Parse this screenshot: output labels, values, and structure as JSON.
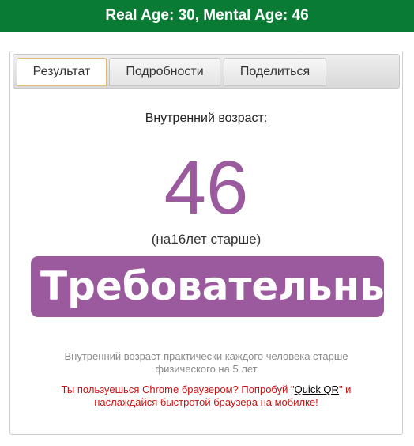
{
  "header": {
    "title": "Real Age: 30, Mental Age: 46"
  },
  "tabs": [
    {
      "label": "Результат",
      "active": true
    },
    {
      "label": "Подробности",
      "active": false
    },
    {
      "label": "Поделиться",
      "active": false
    }
  ],
  "result": {
    "label": "Внутренний возраст:",
    "age": "46",
    "difference": "(на16лет старше)",
    "type_banner": "Требовательны"
  },
  "note": {
    "line1": "Внутренний возраст практически каждого человека старше",
    "line2": "физического на 5 лет"
  },
  "promo": {
    "text_before": "Ты пользуешься Chrome браузером? Попробуй \"",
    "link": "Quick QR",
    "text_after": "\" и",
    "line2": "наслаждайся быстротой браузера на мобилке!"
  },
  "colors": {
    "header_bg": "#0a7b34",
    "accent_purple": "#9b5a9e",
    "promo_red": "#cc1111"
  }
}
